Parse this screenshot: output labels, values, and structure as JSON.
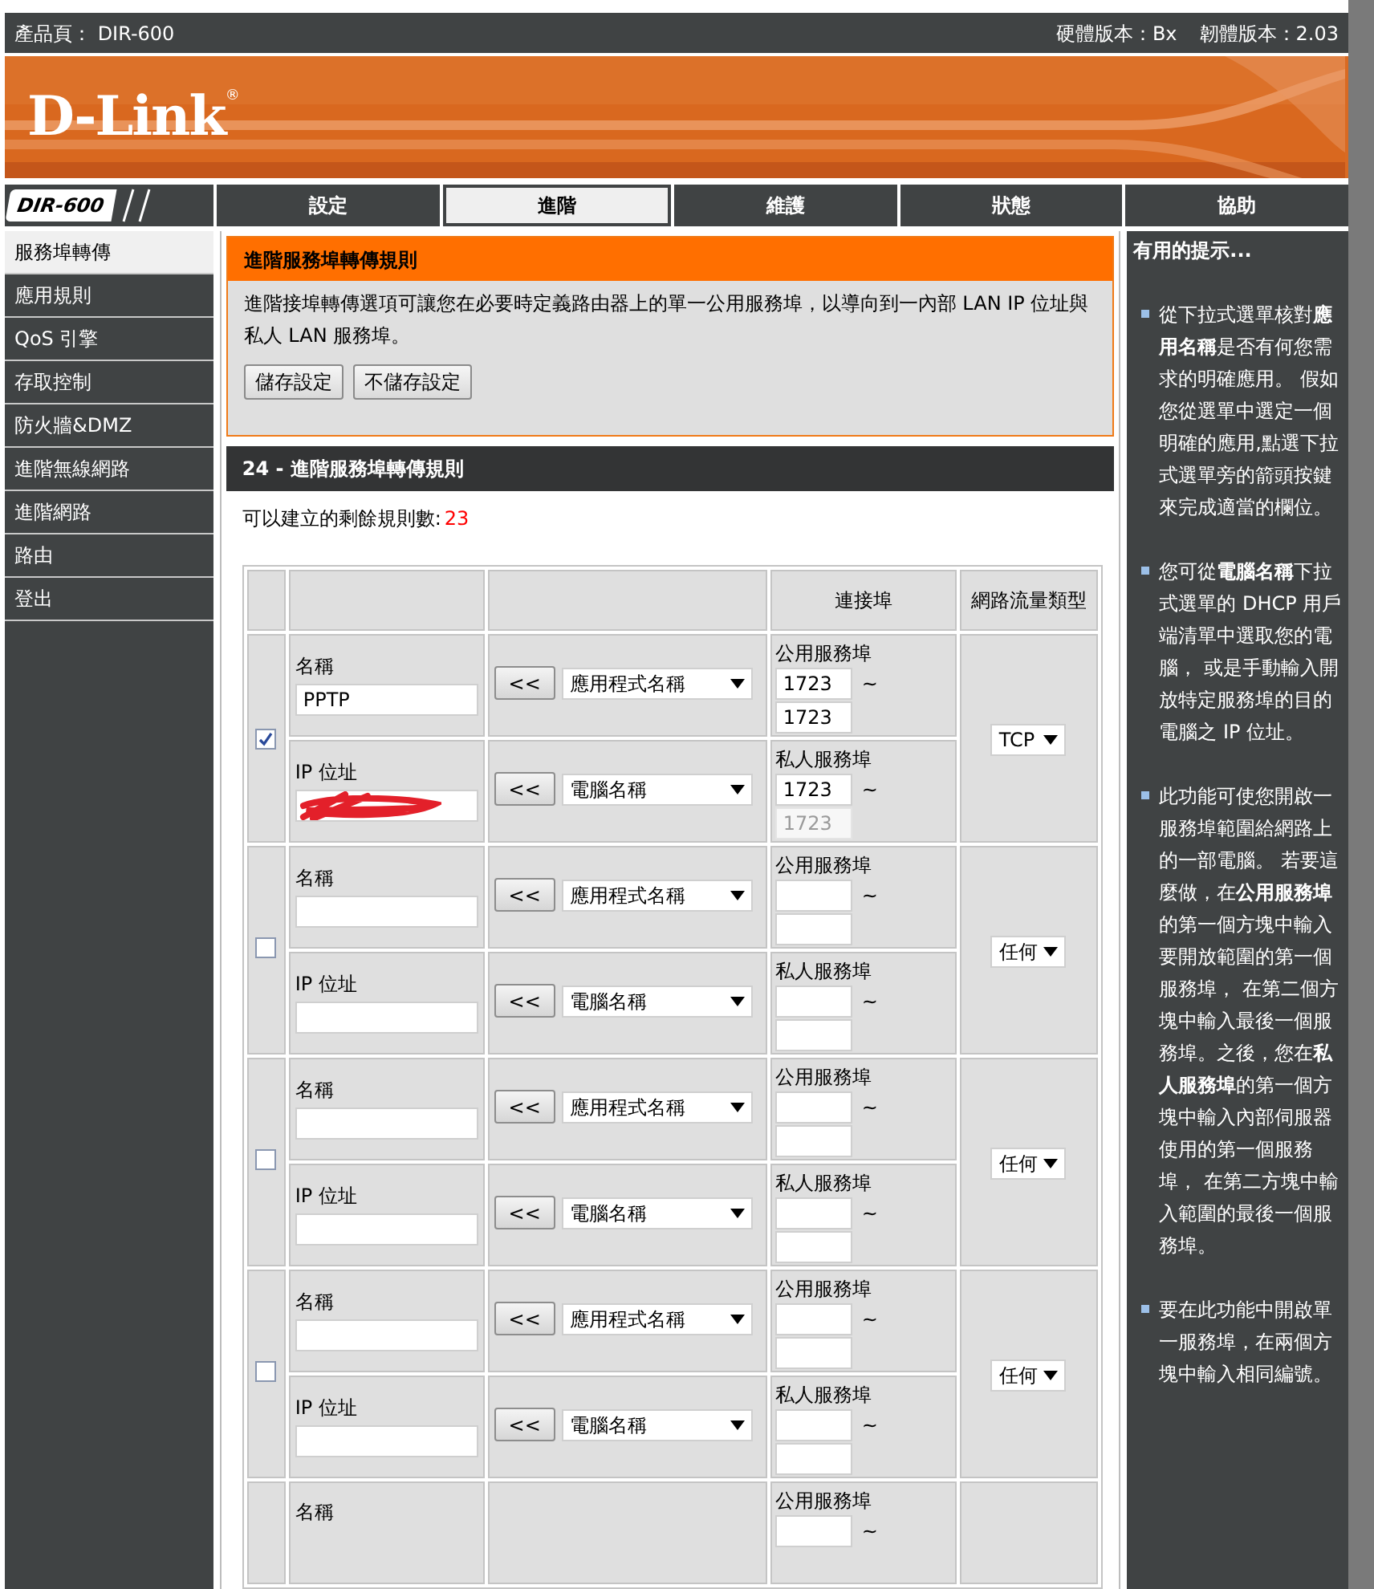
{
  "header": {
    "product": "產品頁： DIR-600",
    "hardware": "硬體版本：Bx",
    "firmware": "韌體版本：2.03"
  },
  "logo": {
    "text": "D-Link",
    "mark": "®"
  },
  "model_badge": "DIR-600",
  "tabs": [
    {
      "label": "設定",
      "selected": false
    },
    {
      "label": "進階",
      "selected": true
    },
    {
      "label": "維護",
      "selected": false
    },
    {
      "label": "狀態",
      "selected": false
    },
    {
      "label": "協助",
      "selected": false
    }
  ],
  "sidebar": {
    "items": [
      {
        "label": "服務埠轉傳",
        "selected": true
      },
      {
        "label": "應用規則",
        "selected": false
      },
      {
        "label": "QoS 引擎",
        "selected": false
      },
      {
        "label": "存取控制",
        "selected": false
      },
      {
        "label": "防火牆&DMZ",
        "selected": false
      },
      {
        "label": "進階無線網路",
        "selected": false
      },
      {
        "label": "進階網路",
        "selected": false
      },
      {
        "label": "路由",
        "selected": false
      },
      {
        "label": "登出",
        "selected": false
      }
    ]
  },
  "intro": {
    "title": "進階服務埠轉傳規則",
    "text": "進階接埠轉傳選項可讓您在必要時定義路由器上的單一公用服務埠，以導向到一內部 LAN IP 位址與私人 LAN 服務埠。",
    "buttons": [
      "儲存設定",
      "不儲存設定"
    ]
  },
  "rules": {
    "title": "24 - 進階服務埠轉傳規則",
    "remaining_label": "可以建立的剩餘規則數:",
    "remaining": "23",
    "columns": [
      "連接埠",
      "網路流量類型"
    ],
    "rows": [
      {
        "checked": true,
        "name_label": "名稱",
        "name": "PPTP",
        "app_button": "<<",
        "app_select": "應用程式名稱",
        "ip_label": "IP 位址",
        "ip_redacted": true,
        "pc_button": "<<",
        "pc_select": "電腦名稱",
        "public_label": "公用服務埠",
        "public_start": "1723",
        "public_sep": "~",
        "public_end": "1723",
        "private_label": "私人服務埠",
        "private_start": "1723",
        "private_sep": "~",
        "private_end": "1723",
        "private_end_disabled": true,
        "traffic": "TCP"
      },
      {
        "checked": false,
        "name_label": "名稱",
        "app_button": "<<",
        "app_select": "應用程式名稱",
        "ip_label": "IP 位址",
        "ip_redacted": false,
        "pc_button": "<<",
        "pc_select": "電腦名稱",
        "public_label": "公用服務埠",
        "public_sep": "~",
        "private_label": "私人服務埠",
        "private_sep": "~",
        "private_end_disabled": false,
        "traffic": "任何"
      },
      {
        "checked": false,
        "name_label": "名稱",
        "app_button": "<<",
        "app_select": "應用程式名稱",
        "ip_label": "IP 位址",
        "ip_redacted": false,
        "pc_button": "<<",
        "pc_select": "電腦名稱",
        "public_label": "公用服務埠",
        "public_sep": "~",
        "private_label": "私人服務埠",
        "private_sep": "~",
        "private_end_disabled": false,
        "traffic": "任何"
      },
      {
        "checked": false,
        "name_label": "名稱",
        "app_button": "<<",
        "app_select": "應用程式名稱",
        "ip_label": "IP 位址",
        "ip_redacted": false,
        "pc_button": "<<",
        "pc_select": "電腦名稱",
        "public_label": "公用服務埠",
        "public_sep": "~",
        "private_label": "私人服務埠",
        "private_sep": "~",
        "private_end_disabled": false,
        "traffic": "任何"
      }
    ],
    "cut_row": {
      "name_label": "名稱",
      "public_label": "公用服務埠",
      "public_sep": "~"
    }
  },
  "tips": {
    "title": "有用的提示...",
    "items": [
      "從下拉式選單核對**應用名稱**是否有何您需求的明確應用。 假如您從選單中選定一個明確的應用,點選下拉式選單旁的箭頭按鍵來完成適當的欄位。",
      "您可從**電腦名稱**下拉式選單的 DHCP 用戶端清單中選取您的電腦， 或是手動輸入開放特定服務埠的目的電腦之 IP 位址。",
      "此功能可使您開啟一服務埠範圍給網路上的一部電腦。 若要這麼做，在**公用服務埠**的第一個方塊中輸入要開放範圍的第一個服務埠， 在第二個方塊中輸入最後一個服務埠。之後，您在**私人服務埠**的第一個方塊中輸入內部伺服器使用的第一個服務埠， 在第二方塊中輸入範圍的最後一個服務埠。",
      "要在此功能中開啟單一服務埠，在兩個方塊中輸入相同編號。"
    ]
  }
}
